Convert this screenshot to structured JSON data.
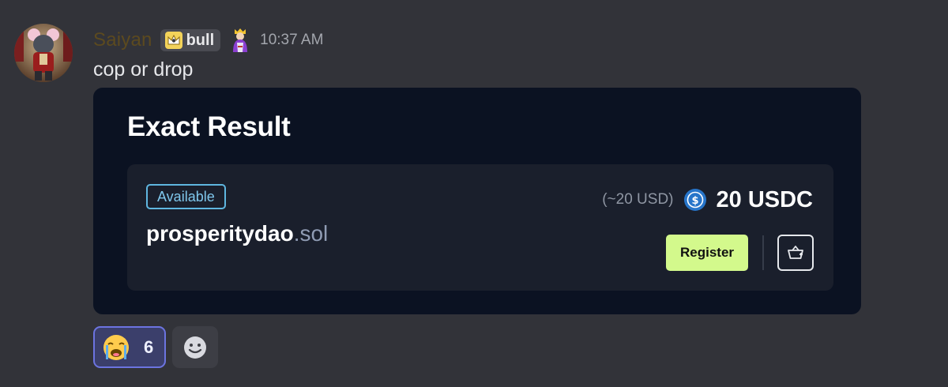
{
  "message": {
    "author": {
      "username": "Saiyan",
      "role_tag": "bull",
      "avatar_icon": "avatar-icon",
      "name_color": "#5c4a1f"
    },
    "timestamp": "10:37 AM",
    "content": "cop or drop"
  },
  "embed": {
    "title": "Exact Result",
    "card": {
      "status": "Available",
      "domain_name": "prosperitydao",
      "domain_tld": ".sol",
      "price_usd": "(~20 USD)",
      "price": "20 USDC",
      "currency_icon": "usdc-icon",
      "register_label": "Register",
      "cart_icon": "add-to-cart-icon"
    },
    "colors": {
      "background": "#0b1222",
      "card": "#1a1f2c",
      "accent": "#d3f98c",
      "badge": "#5fb6e0"
    }
  },
  "reactions": [
    {
      "emoji": "loudly-crying-face",
      "count": "6",
      "active": true
    }
  ],
  "add_reaction_icon": "add-reaction-icon"
}
